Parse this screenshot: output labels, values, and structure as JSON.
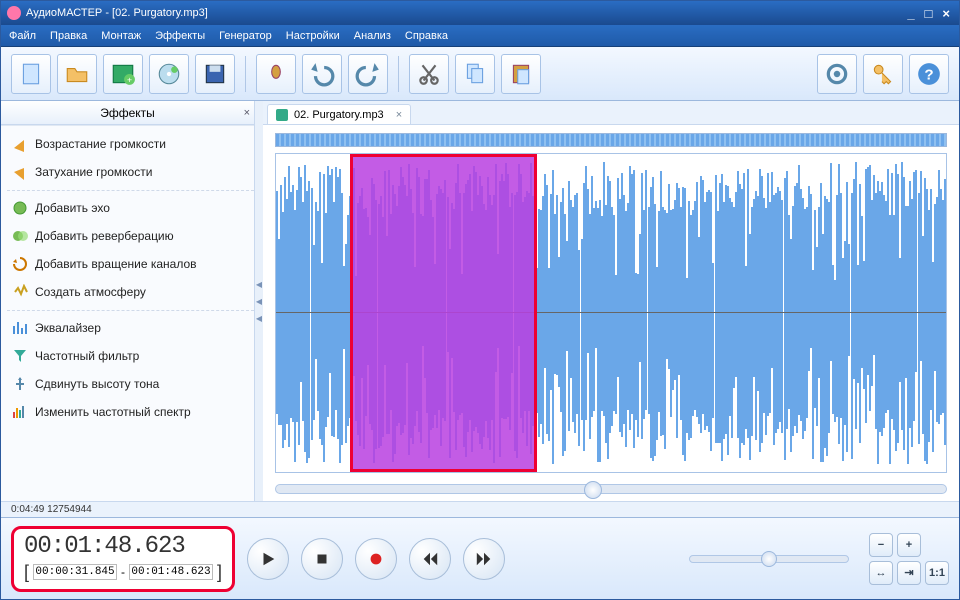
{
  "window": {
    "title": "АудиоМАСТЕР - [02. Purgatory.mp3]"
  },
  "menu": {
    "file": "Файл",
    "edit": "Правка",
    "montage": "Монтаж",
    "effects": "Эффекты",
    "generator": "Генератор",
    "settings": "Настройки",
    "analysis": "Анализ",
    "help": "Справка"
  },
  "sidebar": {
    "title": "Эффекты",
    "items": [
      {
        "label": "Возрастание громкости",
        "icon": "vol-up"
      },
      {
        "label": "Затухание громкости",
        "icon": "vol-down"
      },
      {
        "label": "Добавить эхо",
        "icon": "echo"
      },
      {
        "label": "Добавить реверберацию",
        "icon": "reverb"
      },
      {
        "label": "Добавить вращение каналов",
        "icon": "rotate"
      },
      {
        "label": "Создать атмосферу",
        "icon": "atmos"
      },
      {
        "label": "Эквалайзер",
        "icon": "eq"
      },
      {
        "label": "Частотный фильтр",
        "icon": "filter"
      },
      {
        "label": "Сдвинуть высоту тона",
        "icon": "pitch"
      },
      {
        "label": "Изменить частотный спектр",
        "icon": "spectrum"
      }
    ]
  },
  "tab": {
    "label": "02. Purgatory.mp3"
  },
  "status": {
    "text": "0:04:49 12754944"
  },
  "time": {
    "current": "00:01:48.623",
    "sel_start": "00:00:31.845",
    "sel_end": "00:01:48.623"
  },
  "small": {
    "ratio": "1:1"
  }
}
